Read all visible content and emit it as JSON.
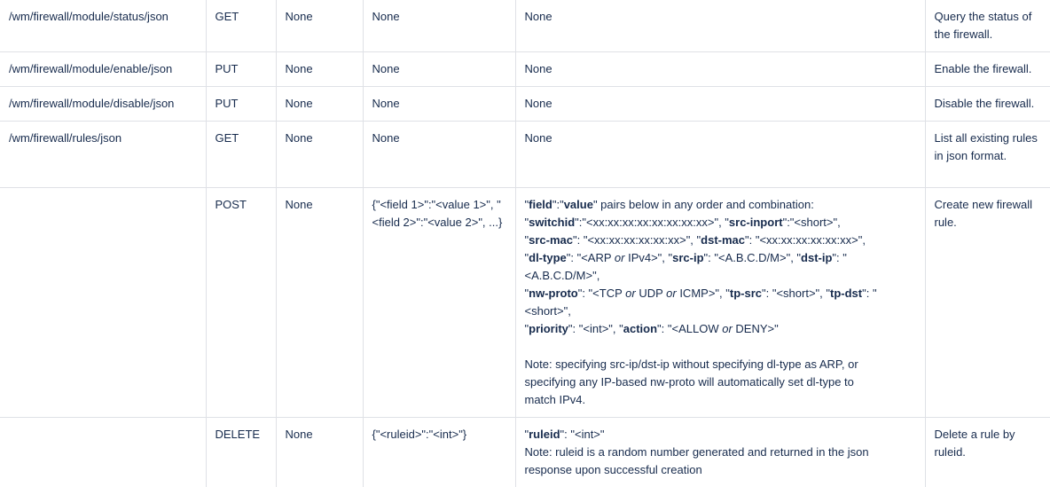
{
  "rows": [
    {
      "uri": "/wm/firewall/module/status/json",
      "method": "GET",
      "param1": "None",
      "data": "None",
      "notes": "None",
      "description": "Query the status of the firewall."
    },
    {
      "uri": "/wm/firewall/module/enable/json",
      "method": "PUT",
      "param1": "None",
      "data": "None",
      "notes": "None",
      "description": "Enable the firewall."
    },
    {
      "uri": "/wm/firewall/module/disable/json",
      "method": "PUT",
      "param1": "None",
      "data": "None",
      "notes": "None",
      "description": "Disable the firewall."
    },
    {
      "uri": "/wm/firewall/rules/json",
      "method": "GET",
      "param1": "None",
      "data": "None",
      "notes": "None",
      "description": "List all existing rules in json format."
    },
    {
      "uri": "",
      "method": "POST",
      "param1": "None",
      "data": "{\"<field 1>\":\"<value 1>\", \"<field 2>\":\"<value 2>\", ...}",
      "notes_rich": {
        "l1_b1": "field",
        "l1_t1": "\":\"",
        "l1_b2": "value",
        "l1_t2": "\" pairs below in any order and combination:",
        "l2_b1": "switchid",
        "l2_t1": "\":\"<xx:xx:xx:xx:xx:xx:xx:xx>\", \"",
        "l2_b2": "src-inport",
        "l2_t2": "\":\"<short>\",",
        "l3_b1": "src-mac",
        "l3_t1": "\": \"<xx:xx:xx:xx:xx:xx>\", \"",
        "l3_b2": "dst-mac",
        "l3_t2": "\": \"<xx:xx:xx:xx:xx:xx>\",",
        "l4_b1": "dl-type",
        "l4_t1": "\": \"<ARP ",
        "l4_i1": "or",
        "l4_t2": " IPv4>\", \"",
        "l4_b2": "src-ip",
        "l4_t3": "\": \"<A.B.C.D/M>\", \"",
        "l4_b3": "dst-ip",
        "l4_t4": "\": \"",
        "l5": "<A.B.C.D/M>\",",
        "l6_b1": "nw-proto",
        "l6_t1": "\": \"<TCP ",
        "l6_i1": "or",
        "l6_t2": " UDP ",
        "l6_i2": "or",
        "l6_t3": " ICMP>\", \"",
        "l6_b2": "tp-src",
        "l6_t4": "\": \"<short>\", \"",
        "l6_b3": "tp-dst",
        "l6_t5": "\": \"",
        "l7": "<short>\",",
        "l8_b1": "priority",
        "l8_t1": "\": \"<int>\", \"",
        "l8_b2": "action",
        "l8_t2": "\": \"<ALLOW ",
        "l8_i1": "or",
        "l8_t3": " DENY>\"",
        "note1": "Note: specifying src-ip/dst-ip without specifying dl-type as ARP, or",
        "note2": "specifying any IP-based nw-proto will automatically set dl-type to",
        "note3": "match IPv4."
      },
      "description": "Create new firewall rule."
    },
    {
      "uri": "",
      "method": "DELETE",
      "param1": "None",
      "data": "{\"<ruleid>\":\"<int>\"}",
      "notes_rich": {
        "l1_b1": "ruleid",
        "l1_t1": "\": \"<int>\"",
        "note1": "Note: ruleid is a random number generated and returned in the json",
        "note2": "response upon successful creation"
      },
      "description": "Delete a rule by ruleid."
    }
  ]
}
